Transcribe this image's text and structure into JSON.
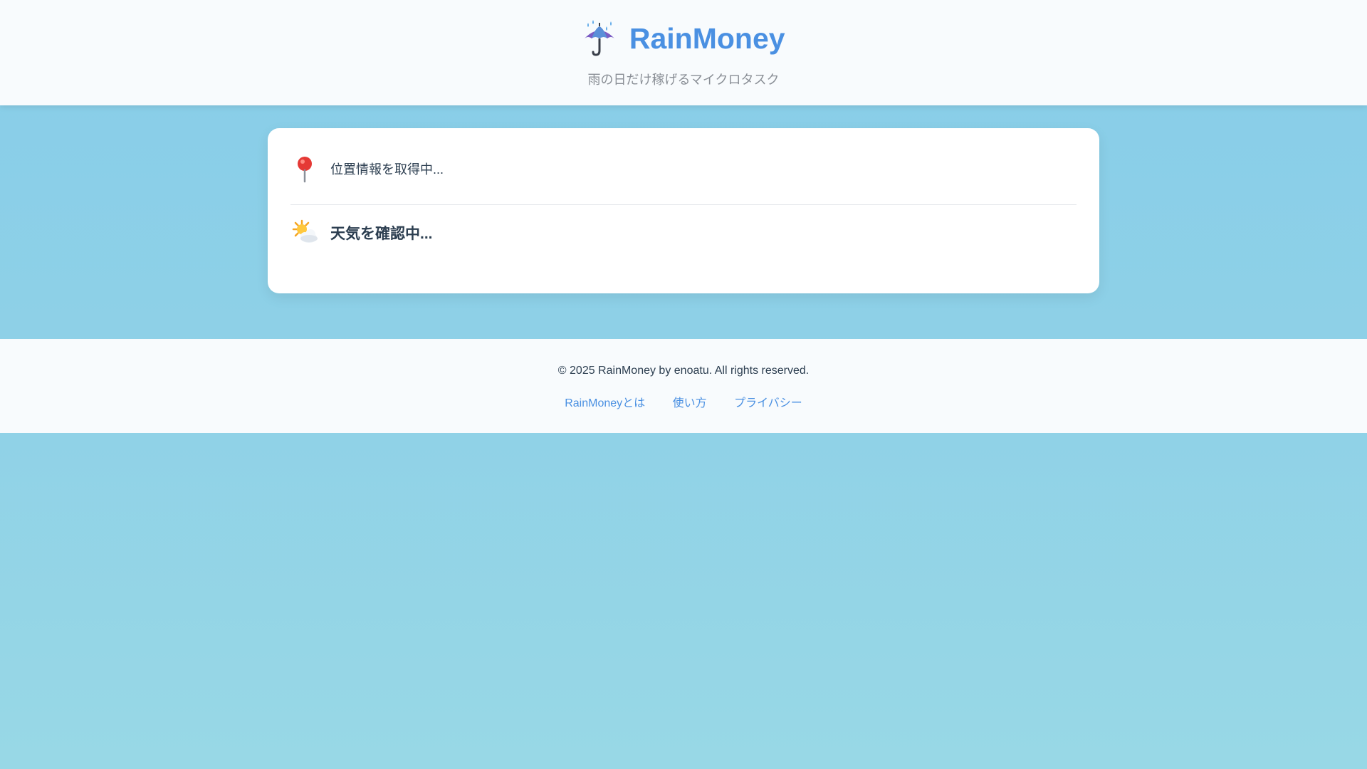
{
  "header": {
    "title": "RainMoney",
    "tagline": "雨の日だけ稼げるマイクロタスク",
    "logo_icon": "umbrella-with-rain-icon"
  },
  "status": {
    "location": {
      "icon": "location-pin-icon",
      "text": "位置情報を取得中..."
    },
    "weather": {
      "icon": "sun-behind-cloud-icon",
      "text": "天気を確認中..."
    }
  },
  "footer": {
    "copyright": "© 2025 RainMoney by enoatu. All rights reserved.",
    "links": [
      {
        "label": "RainMoneyとは"
      },
      {
        "label": "使い方"
      },
      {
        "label": "プライバシー"
      }
    ]
  },
  "colors": {
    "brand": "#4a90e2",
    "background_top": "#87cde8",
    "background_bottom": "#98d8e6",
    "text": "#2c3e50",
    "muted": "#8a8f96"
  }
}
